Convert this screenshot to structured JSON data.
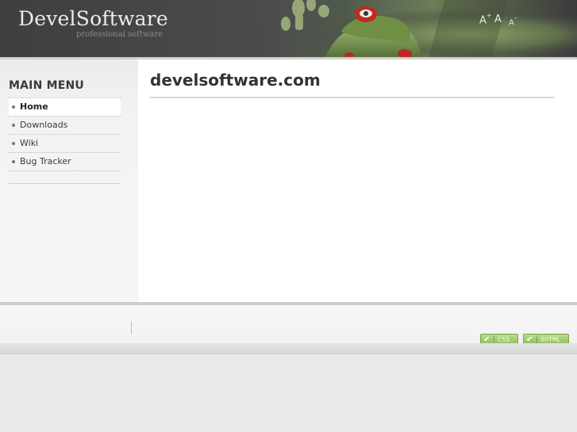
{
  "header": {
    "logo_title": "DevelSoftware",
    "logo_subtitle": "professional software",
    "font_controls": {
      "increase": "A",
      "increase_mark": "+",
      "normal": "A",
      "decrease": "A",
      "decrease_mark": "-"
    }
  },
  "sidebar": {
    "menu_title": "MAIN MENU",
    "items": [
      {
        "label": "Home",
        "active": true
      },
      {
        "label": "Downloads",
        "active": false
      },
      {
        "label": "Wiki",
        "active": false
      },
      {
        "label": "Bug Tracker",
        "active": false
      }
    ]
  },
  "main": {
    "page_title": "develsoftware.com"
  },
  "footer": {
    "badges": {
      "css": "CSS",
      "xhtml": "XHTML"
    }
  },
  "colors": {
    "header_bg": "#3f3f3f",
    "frog_green": "#7a9a4c",
    "badge_green": "#8fbd5c"
  }
}
